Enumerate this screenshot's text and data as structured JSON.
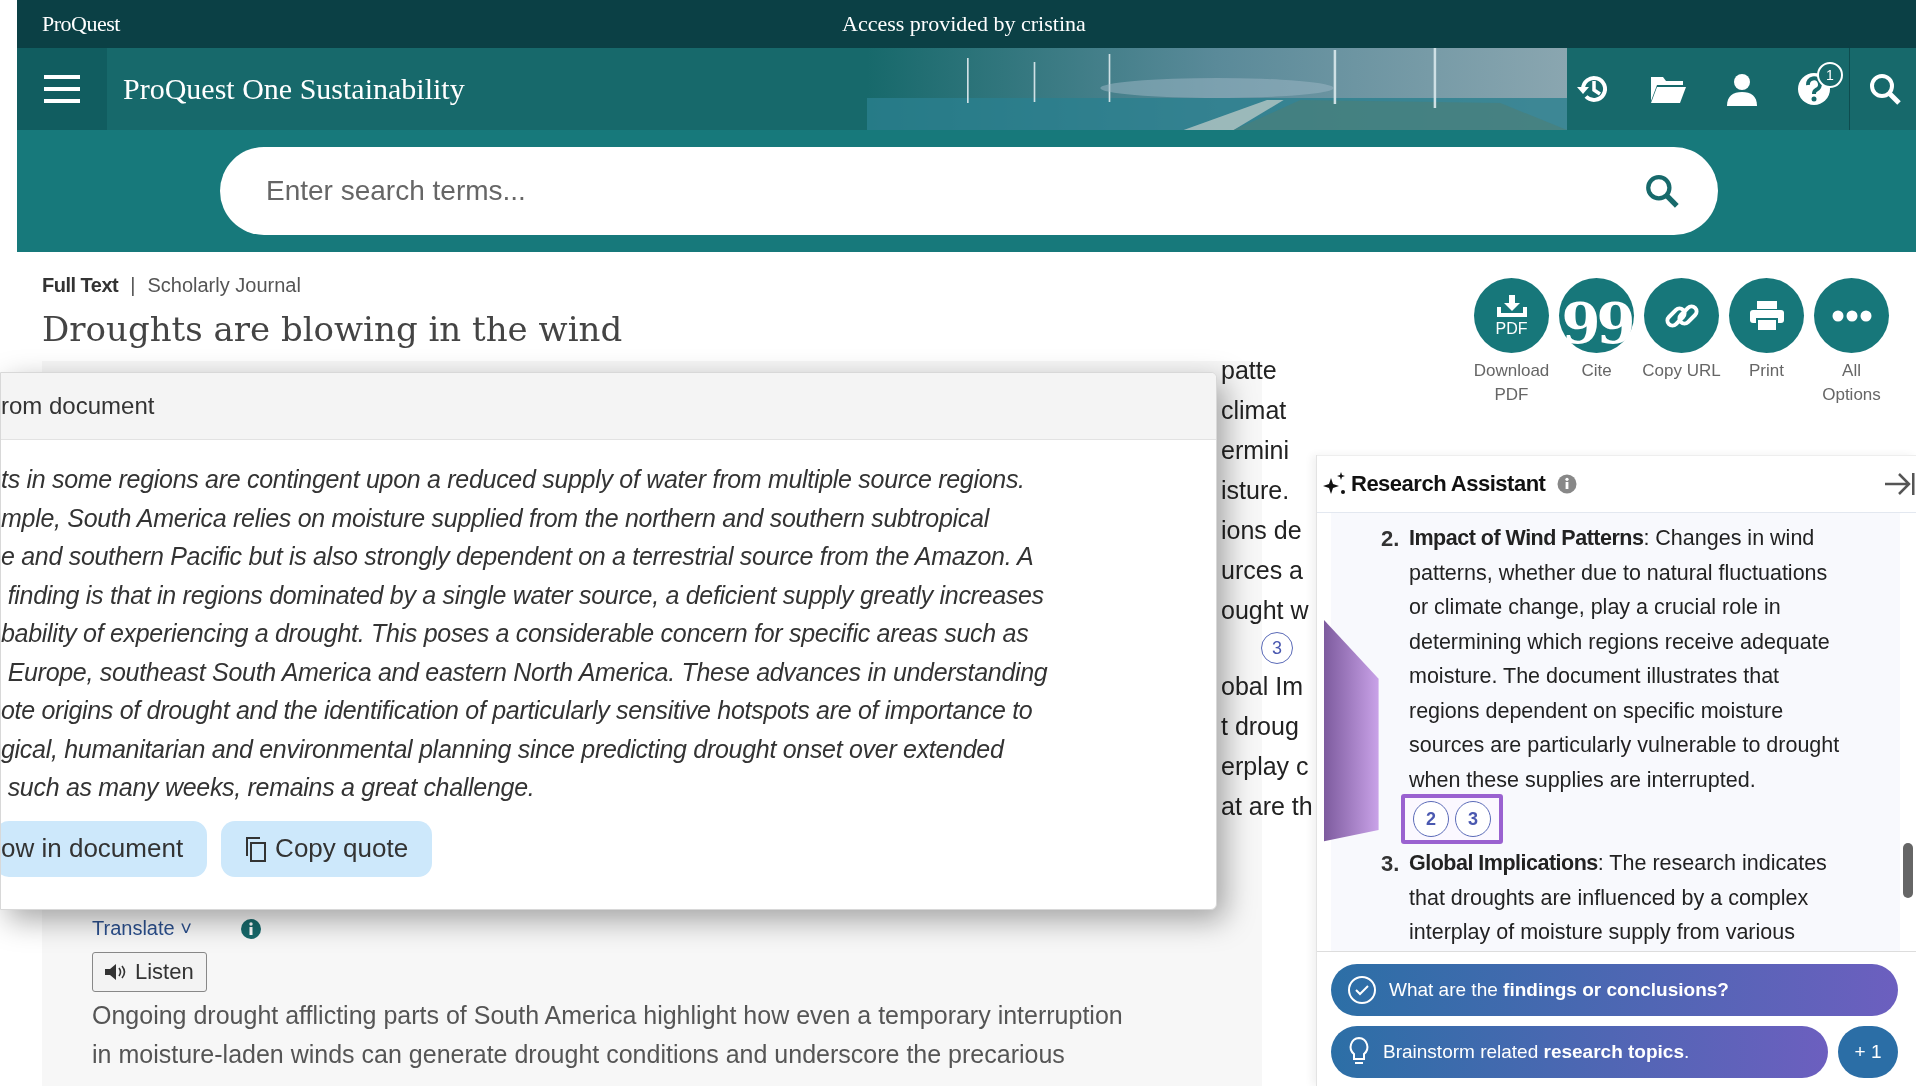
{
  "top_bar": {
    "brand": "ProQuest",
    "access": "Access provided by cristina"
  },
  "header": {
    "title": "ProQuest One Sustainability",
    "help_badge": "1"
  },
  "search": {
    "placeholder": "Enter search terms..."
  },
  "document": {
    "type": "Full Text",
    "separator": "|",
    "source_type": "Scholarly Journal",
    "title": "Droughts are blowing in the wind",
    "translate": "Translate",
    "translate_caret": "˅",
    "listen": "Listen",
    "paragraph_lines": [
      "Ongoing drought afflicting parts of South America highlight how even a temporary interruption",
      "in moisture-laden winds can generate drought conditions and underscore the precarious"
    ]
  },
  "behind_fragments": [
    "patte",
    "climat",
    "ermini",
    "isture.",
    "ions de",
    "urces a",
    "ought w",
    "3",
    "obal Im",
    "t droug",
    "erplay c",
    "at are th"
  ],
  "quote_popup": {
    "title": "rom document",
    "lines": [
      "ts in some regions are contingent upon a reduced supply of water from multiple source regions.",
      "mple, South America relies on moisture supplied from the northern and southern subtropical",
      "e and southern Pacific but is also strongly dependent on a terrestrial source from the Amazon. A",
      " finding is that in regions dominated by a single water source, a deficient supply greatly increases",
      "bability of experiencing a drought. This poses a considerable concern for specific areas such as",
      " Europe, southeast South America and eastern North America. These advances in understanding",
      "ote origins of drought and the identification of particularly sensitive hotspots are of importance to",
      "gical, humanitarian and environmental planning since predicting drought onset over extended",
      " such as many weeks, remains a great challenge."
    ],
    "buttons": [
      {
        "label": "ow in document",
        "kind": "plain"
      },
      {
        "label": "Copy quote",
        "kind": "copy"
      }
    ]
  },
  "actions": [
    {
      "label": [
        "Download",
        "PDF"
      ],
      "kind": "pdf",
      "icon_text": "PDF"
    },
    {
      "label": [
        "Cite"
      ],
      "kind": "cite",
      "icon_text": "99"
    },
    {
      "label": [
        "Copy URL"
      ],
      "kind": "link"
    },
    {
      "label": [
        "Print"
      ],
      "kind": "print"
    },
    {
      "label": [
        "All",
        "Options"
      ],
      "kind": "more"
    }
  ],
  "assistant": {
    "title": "Research Assistant",
    "items": [
      {
        "number": "2.",
        "heading": "Impact of Wind Patterns",
        "text": ": Changes in wind patterns, whether due to natural fluctuations or climate change, play a crucial role in determining which regions receive adequate moisture. The document illustrates that regions dependent on specific moisture sources are particularly vulnerable to drought when these supplies are interrupted.",
        "citations": [
          "2",
          "3"
        ],
        "citations_highlighted": true
      },
      {
        "number": "3.",
        "heading": "Global Implications",
        "text": ": The research indicates that droughts are influenced by a complex interplay of moisture supply from various"
      }
    ],
    "suggestions": [
      {
        "text": "What are the **findings or conclusions?**",
        "kind": "check"
      },
      {
        "text": "Brainstorm related **research topics**.",
        "kind": "idea",
        "extra": "+ 1"
      }
    ]
  }
}
